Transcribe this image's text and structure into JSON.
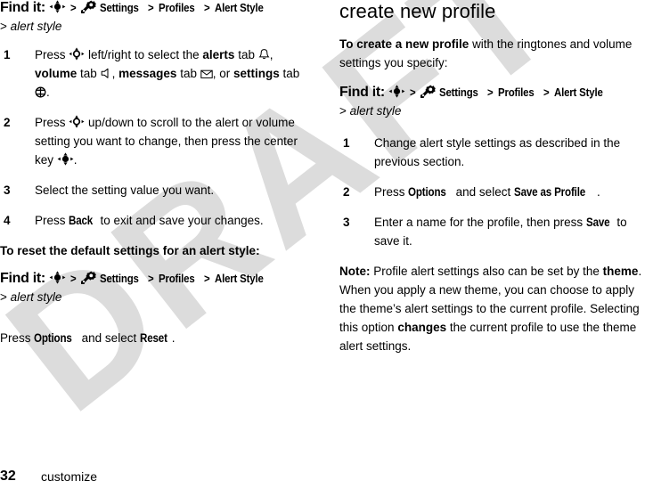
{
  "document": {
    "watermark_text": "DRAFT",
    "watermark_color": "#dcdcdc",
    "background_color": "#ffffff",
    "text_color": "#000000"
  },
  "left_column": {
    "findit_1": {
      "label": "Find it:",
      "sep1": ">",
      "settings": "Settings",
      "sep2": ">",
      "profiles": "Profiles",
      "sep3": ">",
      "alert_style": "Alert Style",
      "sub_gt": ">",
      "sub_italic": "alert style"
    },
    "steps": [
      {
        "num": "1",
        "t1": "Press",
        "t2": "left/right to select the",
        "b1": "alerts",
        "t3": "tab",
        "t4": ",",
        "b2": "volume",
        "t5": "tab",
        "t6": ",",
        "b3": "messages",
        "t7": "tab",
        "t8": ", or",
        "b4": "settings",
        "t9": "tab",
        "t10": "."
      },
      {
        "num": "2",
        "t1": "Press",
        "t2": "up/down to scroll to the alert or volume setting you want to change, then press the center key",
        "t3": "."
      },
      {
        "num": "3",
        "t1": "Select the setting value you want."
      },
      {
        "num": "4",
        "t1": "Press",
        "b1": "Back",
        "t2": "to exit and save your changes."
      }
    ],
    "reset_heading": "To reset the default settings for an alert style:",
    "findit_2": {
      "label": "Find it:",
      "sep1": ">",
      "settings": "Settings",
      "sep2": ">",
      "profiles": "Profiles",
      "sep3": ">",
      "alert_style": "Alert Style",
      "sub_gt": ">",
      "sub_italic": "alert style"
    },
    "reset_para": {
      "t1": "Press",
      "b1": "Options",
      "t2": "and select",
      "b2": "Reset",
      "t3": "."
    }
  },
  "right_column": {
    "title": "create new profile",
    "intro": {
      "b1": "To create a new profile",
      "t1": "with the ringtones and volume settings you specify:"
    },
    "findit": {
      "label": "Find it:",
      "sep1": ">",
      "settings": "Settings",
      "sep2": ">",
      "profiles": "Profiles",
      "sep3": ">",
      "alert_style": "Alert Style",
      "sub_gt": ">",
      "sub_italic": "alert style"
    },
    "steps": [
      {
        "num": "1",
        "t1": "Change alert style settings as described in the previous section."
      },
      {
        "num": "2",
        "t1": "Press",
        "b1": "Options",
        "t2": "and select",
        "b2": "Save as Profile",
        "t3": "."
      },
      {
        "num": "3",
        "t1": "Enter a name for the profile, then press",
        "b1": "Save",
        "t2": "to save it."
      }
    ],
    "note": {
      "b0": "Note:",
      "t1": "Profile alert settings also can be set by the",
      "b1": "theme",
      "t2": ". When you apply a new theme, you can choose to apply the theme’s alert settings to the current profile. Selecting this option",
      "b2": "changes",
      "t3": "the current profile to use the theme alert settings."
    }
  },
  "footer": {
    "page_number": "32",
    "section": "customize"
  },
  "icons": {
    "nav_key": "navigation-key-icon",
    "settings_gear": "settings-gear-icon",
    "alerts_bell": "bell-icon",
    "volume_speaker": "speaker-icon",
    "messages_envelope": "envelope-icon",
    "settings_tab": "settings-tab-icon"
  }
}
